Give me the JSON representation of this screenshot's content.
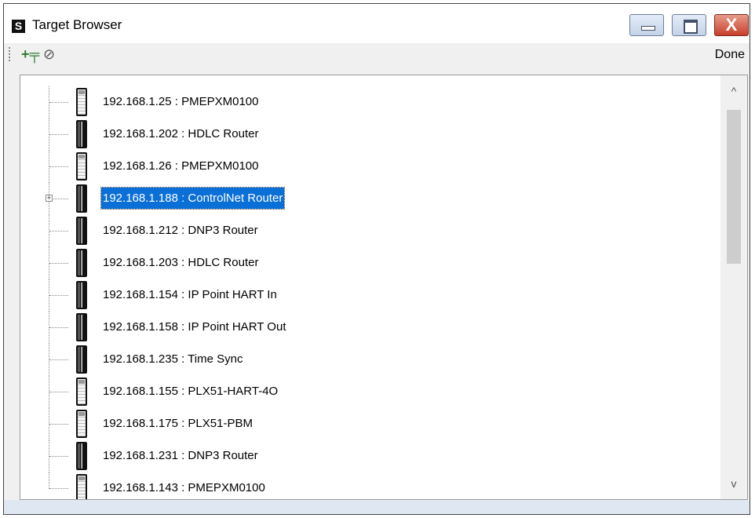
{
  "window": {
    "title": "Target Browser",
    "app_icon": "S",
    "controls": {
      "minimize": "minimize-icon",
      "maximize": "maximize-icon",
      "close": "close-icon"
    },
    "close_glyph": "X"
  },
  "toolbar": {
    "connect_icon": "connect-plug-icon",
    "refresh_icon": "refresh-icon",
    "connect_glyph": "+╤",
    "refresh_glyph": "⊘",
    "done_label": "Done"
  },
  "colors": {
    "selection": "#0a6fd6",
    "close_button": "#c7402a"
  },
  "tree": {
    "items": [
      {
        "label": "192.168.1.25 : PMEPXM0100",
        "device": "light"
      },
      {
        "label": "192.168.1.202 : HDLC Router",
        "device": "dark"
      },
      {
        "label": "192.168.1.26 : PMEPXM0100",
        "device": "light"
      },
      {
        "label": "192.168.1.188 : ControlNet Router",
        "device": "dark",
        "selected": true,
        "expandable": true
      },
      {
        "label": "192.168.1.212 : DNP3 Router",
        "device": "dark"
      },
      {
        "label": "192.168.1.203 : HDLC Router",
        "device": "dark"
      },
      {
        "label": "192.168.1.154 : IP Point HART In",
        "device": "dark"
      },
      {
        "label": "192.168.1.158 : IP Point HART Out",
        "device": "dark"
      },
      {
        "label": "192.168.1.235 : Time Sync",
        "device": "dark"
      },
      {
        "label": "192.168.1.155 : PLX51-HART-4O",
        "device": "light"
      },
      {
        "label": "192.168.1.175 : PLX51-PBM",
        "device": "light"
      },
      {
        "label": "192.168.1.231 : DNP3 Router",
        "device": "dark"
      },
      {
        "label": "192.168.1.143 : PMEPXM0100",
        "device": "light"
      }
    ]
  },
  "scrollbar": {
    "up_glyph": "^",
    "down_glyph": "v"
  }
}
